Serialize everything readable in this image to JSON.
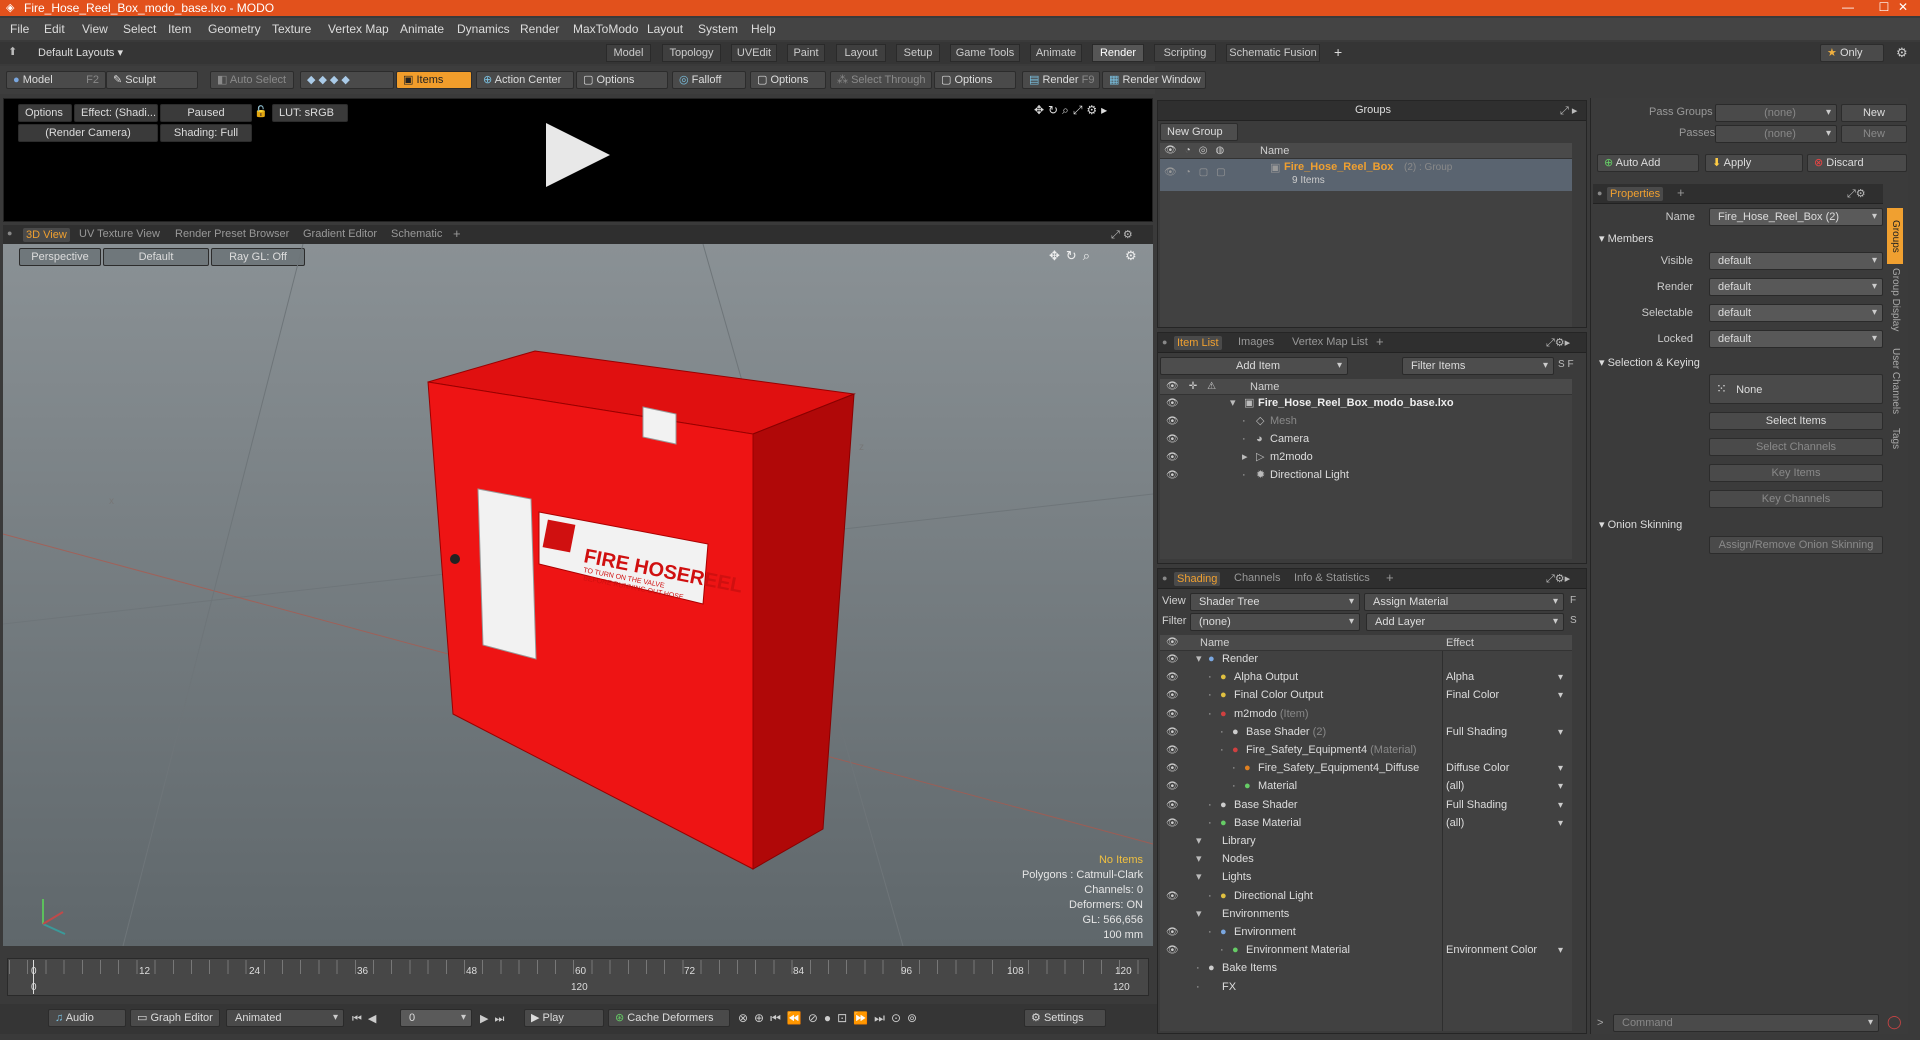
{
  "window": {
    "title": "Fire_Hose_Reel_Box_modo_base.lxo - MODO"
  },
  "menu": [
    "File",
    "Edit",
    "View",
    "Select",
    "Item",
    "Geometry",
    "Texture",
    "Vertex Map",
    "Animate",
    "Dynamics",
    "Render",
    "MaxToModo",
    "Layout",
    "System",
    "Help"
  ],
  "layout_dropdown": "Default Layouts",
  "layout_tabs": [
    "Model",
    "Topology",
    "UVEdit",
    "Paint",
    "Layout",
    "Setup",
    "Game Tools",
    "Animate",
    "Render",
    "Scripting",
    "Schematic Fusion"
  ],
  "selected_layout_tab": "Render",
  "only_label": "Only",
  "toolbar": {
    "model": "Model",
    "model_key": "F2",
    "sculpt": "Sculpt",
    "auto_select": "Auto Select",
    "items": "Items",
    "action_center": "Action Center",
    "options1": "Options",
    "falloff": "Falloff",
    "options2": "Options",
    "select_through": "Select Through",
    "options3": "Options",
    "render": "Render",
    "render_key": "F9",
    "render_window": "Render Window"
  },
  "preview": {
    "options": "Options",
    "effect": "Effect: (Shadi...",
    "paused": "Paused",
    "lut": "LUT: sRGB",
    "camera": "(Render Camera)",
    "shading": "Shading: Full"
  },
  "view_tabs": [
    "3D View",
    "UV Texture View",
    "Render Preset Browser",
    "Gradient Editor",
    "Schematic"
  ],
  "viewport": {
    "perspective": "Perspective",
    "default": "Default",
    "raygl": "Ray GL: Off",
    "info": [
      "No Items",
      "Polygons : Catmull-Clark",
      "Channels: 0",
      "Deformers: ON",
      "GL: 566,656",
      "100 mm"
    ],
    "sign_title": "FIRE HOSEREEL",
    "sign_sub1": "TO TURN ON THE VALVE",
    "sign_sub2": "BEFORE RUNNING OUT HOSE"
  },
  "groups": {
    "title": "Groups",
    "new_group": "New Group",
    "col_name": "Name",
    "item_name": "Fire_Hose_Reel_Box",
    "item_suffix": "(2) : Group",
    "item_count": "9 Items"
  },
  "itemlist": {
    "tabs": [
      "Item List",
      "Images",
      "Vertex Map List"
    ],
    "add_item": "Add Item",
    "filter": "Filter Items",
    "col_name": "Name",
    "items": [
      {
        "name": "Fire_Hose_Reel_Box_modo_base.lxo",
        "indent": 0,
        "bold": true
      },
      {
        "name": "Mesh",
        "indent": 1,
        "dim": true
      },
      {
        "name": "Camera",
        "indent": 1
      },
      {
        "name": "m2modo",
        "indent": 1
      },
      {
        "name": "Directional Light",
        "indent": 1
      }
    ]
  },
  "shading": {
    "tabs": [
      "Shading",
      "Channels",
      "Info & Statistics"
    ],
    "view_label": "View",
    "view_value": "Shader Tree",
    "assign": "Assign Material",
    "filter_label": "Filter",
    "filter_value": "(none)",
    "add_layer": "Add Layer",
    "col_name": "Name",
    "col_effect": "Effect",
    "rows": [
      {
        "name": "Render",
        "suffix": "",
        "effect": "",
        "indent": 0
      },
      {
        "name": "Alpha Output",
        "suffix": "",
        "effect": "Alpha",
        "indent": 1
      },
      {
        "name": "Final Color Output",
        "suffix": "",
        "effect": "Final Color",
        "indent": 1
      },
      {
        "name": "m2modo",
        "suffix": "(Item)",
        "effect": "",
        "indent": 1
      },
      {
        "name": "Base Shader",
        "suffix": "(2)",
        "effect": "Full Shading",
        "indent": 2
      },
      {
        "name": "Fire_Safety_Equipment4",
        "suffix": "(Material)",
        "effect": "",
        "indent": 2
      },
      {
        "name": "Fire_Safety_Equipment4_Diffuse",
        "suffix": "",
        "effect": "Diffuse Color",
        "indent": 3
      },
      {
        "name": "Material",
        "suffix": "",
        "effect": "(all)",
        "indent": 3
      },
      {
        "name": "Base Shader",
        "suffix": "",
        "effect": "Full Shading",
        "indent": 1
      },
      {
        "name": "Base Material",
        "suffix": "",
        "effect": "(all)",
        "indent": 1
      },
      {
        "name": "Library",
        "suffix": "",
        "effect": "",
        "indent": 0
      },
      {
        "name": "Nodes",
        "suffix": "",
        "effect": "",
        "indent": 0
      },
      {
        "name": "Lights",
        "suffix": "",
        "effect": "",
        "indent": 0
      },
      {
        "name": "Directional Light",
        "suffix": "",
        "effect": "",
        "indent": 1
      },
      {
        "name": "Environments",
        "suffix": "",
        "effect": "",
        "indent": 0
      },
      {
        "name": "Environment",
        "suffix": "",
        "effect": "",
        "indent": 1
      },
      {
        "name": "Environment Material",
        "suffix": "",
        "effect": "Environment Color",
        "indent": 2
      },
      {
        "name": "Bake Items",
        "suffix": "",
        "effect": "",
        "indent": 0
      },
      {
        "name": "FX",
        "suffix": "",
        "effect": "",
        "indent": 0
      }
    ]
  },
  "right": {
    "pass_groups": "Pass Groups",
    "passes": "Passes",
    "none": "(none)",
    "new": "New",
    "auto_add": "Auto Add",
    "apply": "Apply",
    "discard": "Discard",
    "properties": "Properties",
    "name_label": "Name",
    "name_value": "Fire_Hose_Reel_Box (2)",
    "members": "Members",
    "visible": "Visible",
    "render": "Render",
    "selectable": "Selectable",
    "locked": "Locked",
    "default": "default",
    "sel_keying": "Selection & Keying",
    "none_label": "None",
    "select_items": "Select Items",
    "select_channels": "Select Channels",
    "key_items": "Key Items",
    "key_channels": "Key Channels",
    "onion": "Onion Skinning",
    "assign_onion": "Assign/Remove Onion Skinning",
    "side_tabs": [
      "Groups",
      "Group Display",
      "User Channels",
      "Tags"
    ],
    "command": "Command"
  },
  "timeline": {
    "ticks_top": [
      "0",
      "12",
      "24",
      "36",
      "48",
      "60",
      "72",
      "84",
      "96",
      "108",
      "120"
    ],
    "ticks_bottom": [
      "0",
      "120",
      "120"
    ]
  },
  "bottom": {
    "audio": "Audio",
    "graph": "Graph Editor",
    "animated": "Animated",
    "frame": "0",
    "play": "Play",
    "cache": "Cache Deformers",
    "settings": "Settings"
  }
}
